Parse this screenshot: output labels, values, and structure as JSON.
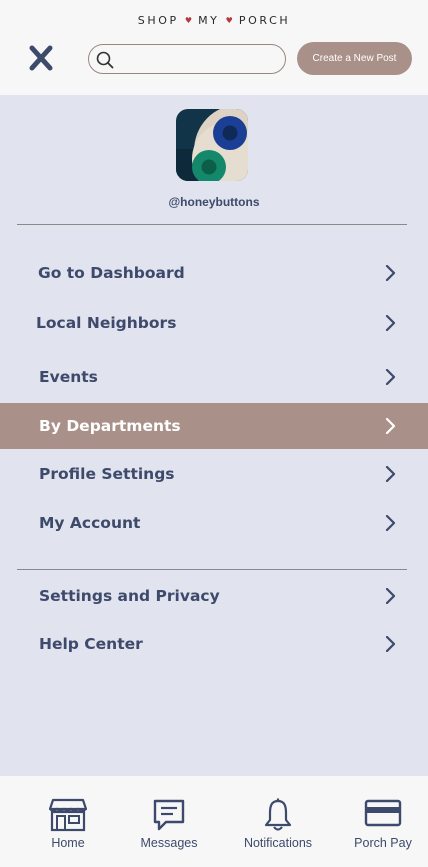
{
  "header": {
    "brand_parts": [
      "SHOP",
      "MY",
      "PORCH"
    ],
    "brand_separator": "♥",
    "search": {
      "value": "",
      "placeholder": ""
    },
    "create_post_label": "Create a New Post"
  },
  "profile": {
    "username": "@honeybuttons"
  },
  "menu": {
    "items": [
      {
        "label": "Go to Dashboard",
        "active": false
      },
      {
        "label": "Local Neighbors",
        "active": false
      },
      {
        "label": "Events",
        "active": false
      },
      {
        "label": "By Departments",
        "active": true
      },
      {
        "label": "Profile Settings",
        "active": false
      },
      {
        "label": "My Account",
        "active": false
      },
      {
        "label": "Settings and Privacy",
        "active": false
      },
      {
        "label": "Help Center",
        "active": false
      }
    ]
  },
  "tabs": [
    {
      "label": "Home",
      "icon": "store-icon"
    },
    {
      "label": "Messages",
      "icon": "message-icon"
    },
    {
      "label": "Notifications",
      "icon": "bell-icon"
    },
    {
      "label": "Porch Pay",
      "icon": "credit-card-icon"
    }
  ],
  "colors": {
    "accent": "#a99088",
    "text_primary": "#3d4a6b",
    "menu_background": "#e1e3ee",
    "brand_heart": "#b33a3a"
  }
}
